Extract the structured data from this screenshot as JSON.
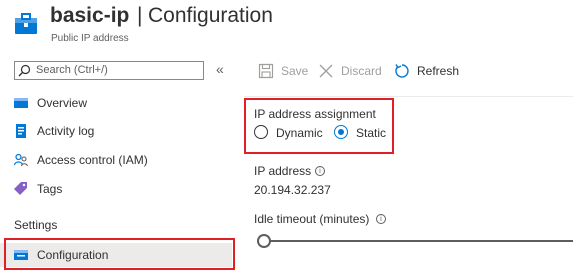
{
  "header": {
    "resource_name": "basic-ip",
    "separator": "|",
    "page_title": "Configuration",
    "resource_type": "Public IP address"
  },
  "sidebar": {
    "search_placeholder": "Search (Ctrl+/)",
    "collapse_label": "«",
    "items": [
      {
        "label": "Overview",
        "icon": "overview-icon"
      },
      {
        "label": "Activity log",
        "icon": "activity-log-icon"
      },
      {
        "label": "Access control (IAM)",
        "icon": "people-icon"
      },
      {
        "label": "Tags",
        "icon": "tag-icon"
      }
    ],
    "settings_heading": "Settings",
    "settings_items": [
      {
        "label": "Configuration",
        "icon": "configuration-icon",
        "selected": true
      }
    ]
  },
  "toolbar": {
    "save_label": "Save",
    "discard_label": "Discard",
    "refresh_label": "Refresh"
  },
  "form": {
    "assignment_label": "IP address assignment",
    "options": [
      "Dynamic",
      "Static"
    ],
    "selected_option": "Static",
    "ip_label": "IP address",
    "ip_value": "20.194.32.237",
    "idle_timeout_label": "Idle timeout (minutes)",
    "info_glyph": "i"
  },
  "colors": {
    "accent": "#0078d4",
    "highlight_box": "#e01f26",
    "selected_nav_bg": "#edebe9"
  }
}
